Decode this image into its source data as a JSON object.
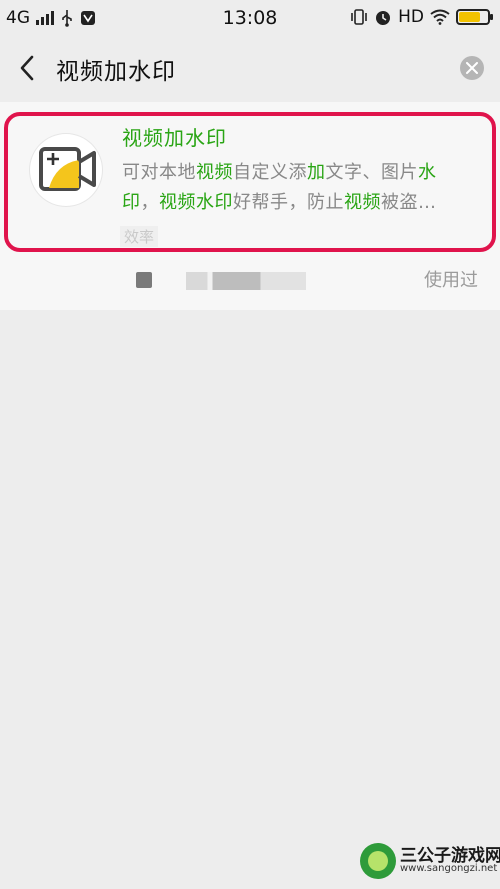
{
  "status_bar": {
    "network": "4G",
    "time": "13:08",
    "hd": "HD"
  },
  "search": {
    "query": "视频加水印"
  },
  "result": {
    "title": "视频加水印",
    "description": [
      {
        "t": "可对本地",
        "h": false
      },
      {
        "t": "视频",
        "h": true
      },
      {
        "t": "自定义添",
        "h": false
      },
      {
        "t": "加",
        "h": true
      },
      {
        "t": "文字、图片",
        "h": false
      },
      {
        "t": "水",
        "h": true
      },
      {
        "t": "\n",
        "h": false
      },
      {
        "t": "印",
        "h": true
      },
      {
        "t": "，",
        "h": false
      },
      {
        "t": "视频水印",
        "h": true
      },
      {
        "t": "好帮手，防止",
        "h": false
      },
      {
        "t": "视频",
        "h": true
      },
      {
        "t": "被盗…",
        "h": false
      }
    ],
    "tag": "效率",
    "developer": "公司",
    "used_label": "使用过"
  },
  "watermark": {
    "title": "三公子游戏网",
    "url": "www.sangongzi.net"
  },
  "colors": {
    "highlight": "#2aa515",
    "card_border": "#e0144c"
  }
}
